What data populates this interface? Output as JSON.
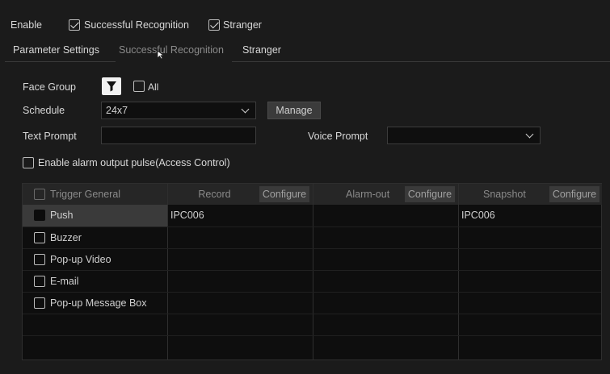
{
  "top": {
    "enable_label": "Enable",
    "successful_recognition_label": "Successful Recognition",
    "stranger_label": "Stranger"
  },
  "tabs": [
    {
      "label": "Parameter Settings"
    },
    {
      "label": "Successful Recognition"
    },
    {
      "label": "Stranger"
    }
  ],
  "form": {
    "face_group_label": "Face Group",
    "all_label": "All",
    "schedule_label": "Schedule",
    "schedule_value": "24x7",
    "manage_label": "Manage",
    "text_prompt_label": "Text Prompt",
    "text_prompt_value": "",
    "voice_prompt_label": "Voice Prompt",
    "voice_prompt_value": "",
    "alarm_pulse_label": "Enable alarm output pulse(Access Control)"
  },
  "table": {
    "trigger_header": "Trigger General",
    "record_header": "Record",
    "alarm_out_header": "Alarm-out",
    "snapshot_header": "Snapshot",
    "configure_label": "Configure",
    "rows": [
      {
        "label": "Push",
        "record": "IPC006",
        "alarm_out": "",
        "snapshot": "IPC006"
      },
      {
        "label": "Buzzer",
        "record": "",
        "alarm_out": "",
        "snapshot": ""
      },
      {
        "label": "Pop-up Video",
        "record": "",
        "alarm_out": "",
        "snapshot": ""
      },
      {
        "label": "E-mail",
        "record": "",
        "alarm_out": "",
        "snapshot": ""
      },
      {
        "label": "Pop-up Message Box",
        "record": "",
        "alarm_out": "",
        "snapshot": ""
      }
    ]
  },
  "colors": {
    "background": "#1b1b1b",
    "table_bg": "#0e0e0e",
    "header_bg": "#262626",
    "selected_row": "#3a3a3a"
  }
}
